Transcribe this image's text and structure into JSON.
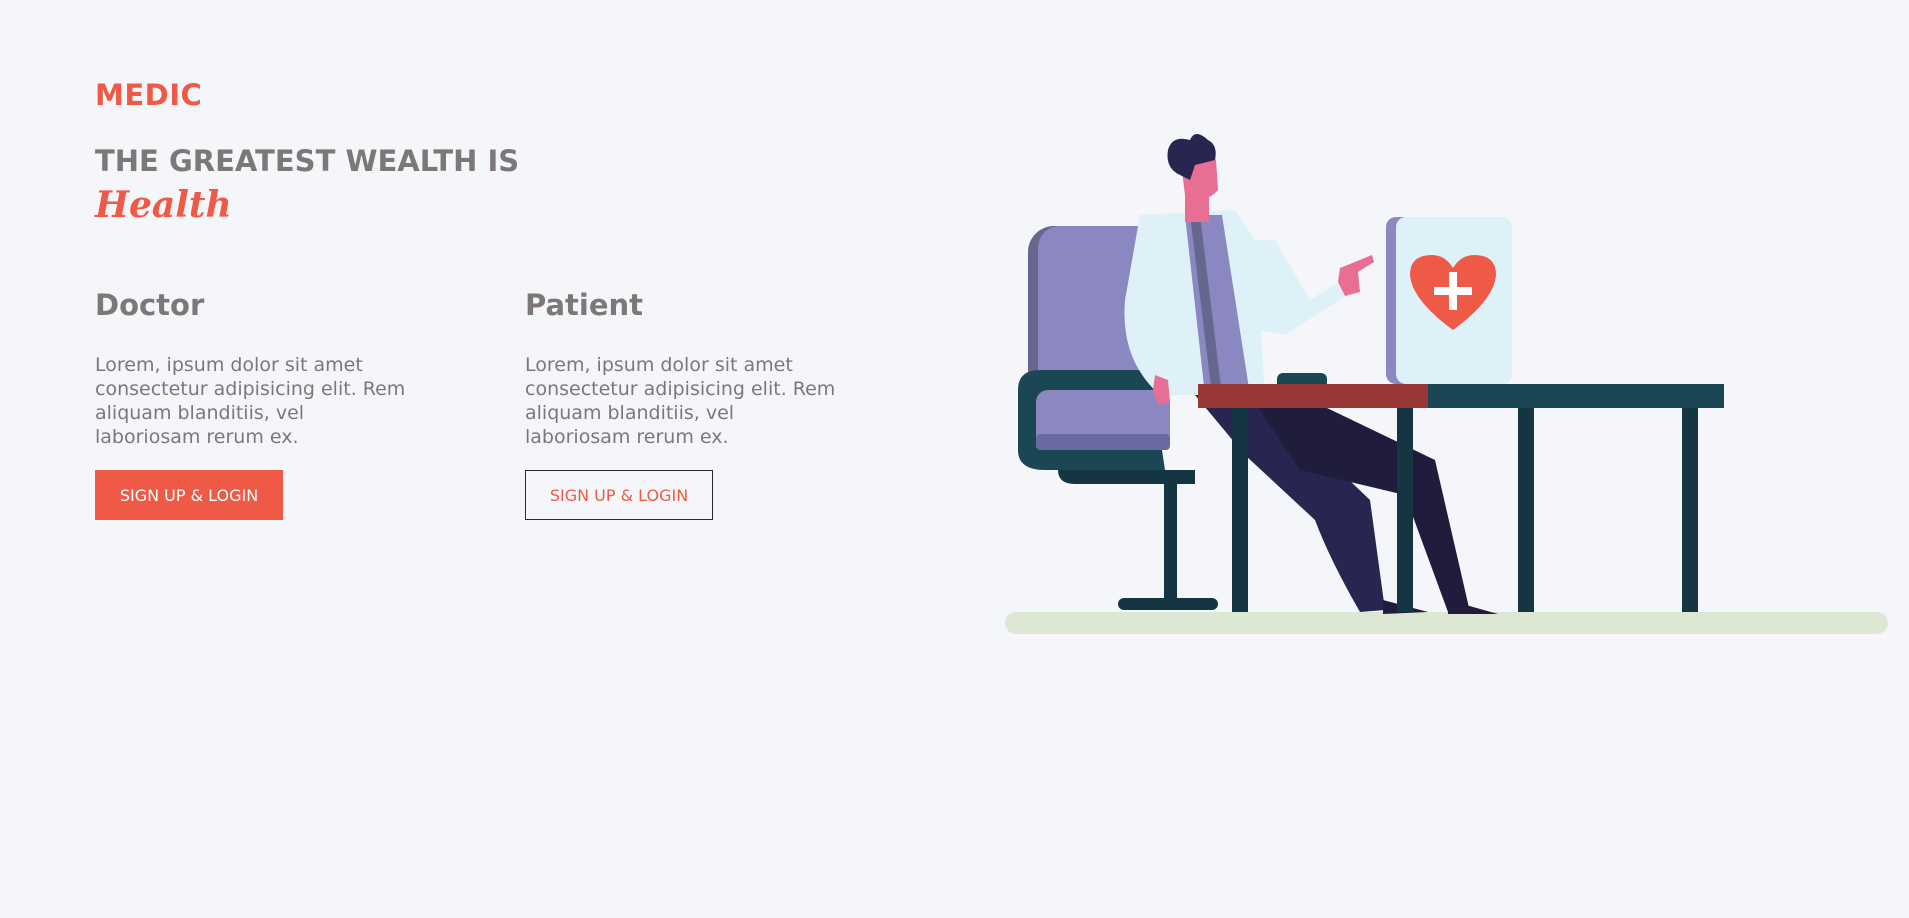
{
  "brand": "MEDIC",
  "hero": {
    "headline": "THE GREATEST WEALTH IS",
    "script_word": "Health"
  },
  "cards": [
    {
      "title": "Doctor",
      "text": "Lorem, ipsum dolor sit amet consectetur adipisicing elit. Rem aliquam blanditiis, vel laboriosam rerum ex.",
      "button": "SIGN UP & LOGIN"
    },
    {
      "title": "Patient",
      "text": "Lorem, ipsum dolor sit amet consectetur adipisicing elit. Rem aliquam blanditiis, vel laboriosam rerum ex.",
      "button": "SIGN UP & LOGIN"
    }
  ],
  "colors": {
    "accent": "#ee5a46",
    "text": "#7d7877",
    "background": "#f4f6fa",
    "desk": "#1b4654",
    "chair": "#8a87c1",
    "floor": "#dce8d4"
  },
  "illustration": {
    "icons": [
      "doctor-figure",
      "office-chair",
      "desk",
      "heart-plus-icon"
    ]
  }
}
